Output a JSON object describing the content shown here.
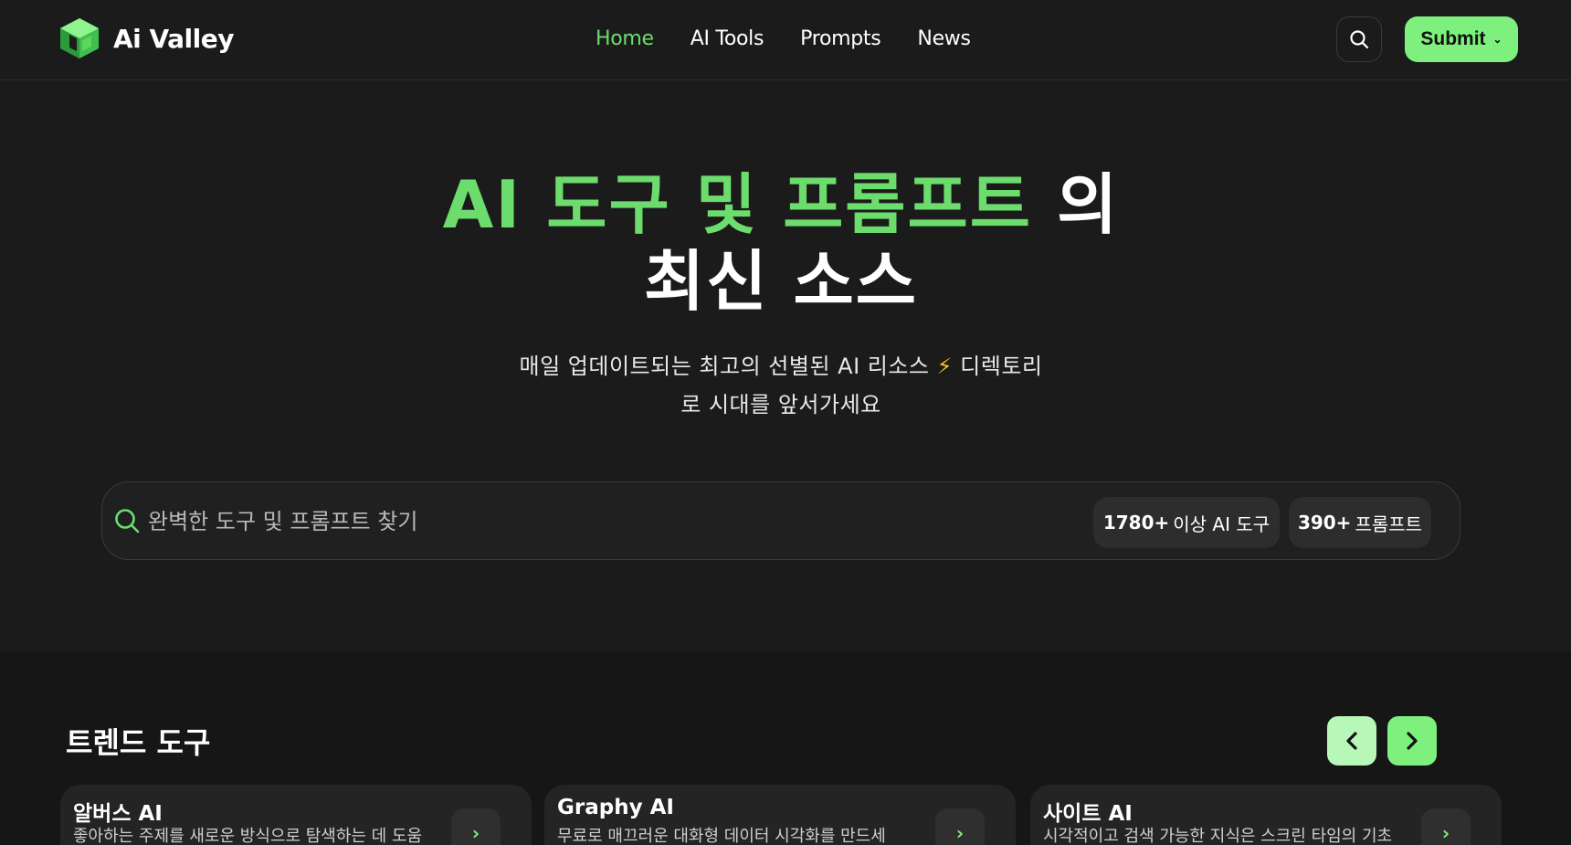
{
  "header": {
    "brand": "Ai Valley",
    "nav": [
      {
        "label": "Home",
        "active": true
      },
      {
        "label": "AI Tools",
        "active": false
      },
      {
        "label": "Prompts",
        "active": false
      },
      {
        "label": "News",
        "active": false
      }
    ],
    "search_icon": "search-icon",
    "submit_label": "Submit"
  },
  "hero": {
    "title_green": "AI 도구 및 프롬프트",
    "title_white_1": " 의",
    "title_white_2": "최신 소스",
    "subtitle_1": "매일 업데이트되는 최고의 선별된 AI 리소스",
    "bolt": "⚡",
    "subtitle_2": "디렉토리",
    "subtitle_3": "로 시대를 앞서가세요"
  },
  "search": {
    "placeholder": "완벽한 도구 및 프롬프트 찾기",
    "stat_tools_count": "1780+",
    "stat_tools_label": "이상 AI 도구",
    "stat_prompts_count": "390+",
    "stat_prompts_label": "프롬프트"
  },
  "trending": {
    "title": "트렌드 도구",
    "prev": "‹",
    "next": "›",
    "cards": [
      {
        "title": "알버스 AI",
        "desc": "좋아하는 주제를 새로운 방식으로 탐색하는 데 도움"
      },
      {
        "title": "Graphy AI",
        "desc": "무료로 매끄러운 대화형 데이터 시각화를 만드세"
      },
      {
        "title": "사이트 AI",
        "desc": "시각적이고 검색 가능한 지식은 스크린 타임의 기초"
      }
    ]
  },
  "colors": {
    "accent": "#6cdc6c",
    "button": "#7ef07e",
    "background": "#1b1b1b"
  }
}
